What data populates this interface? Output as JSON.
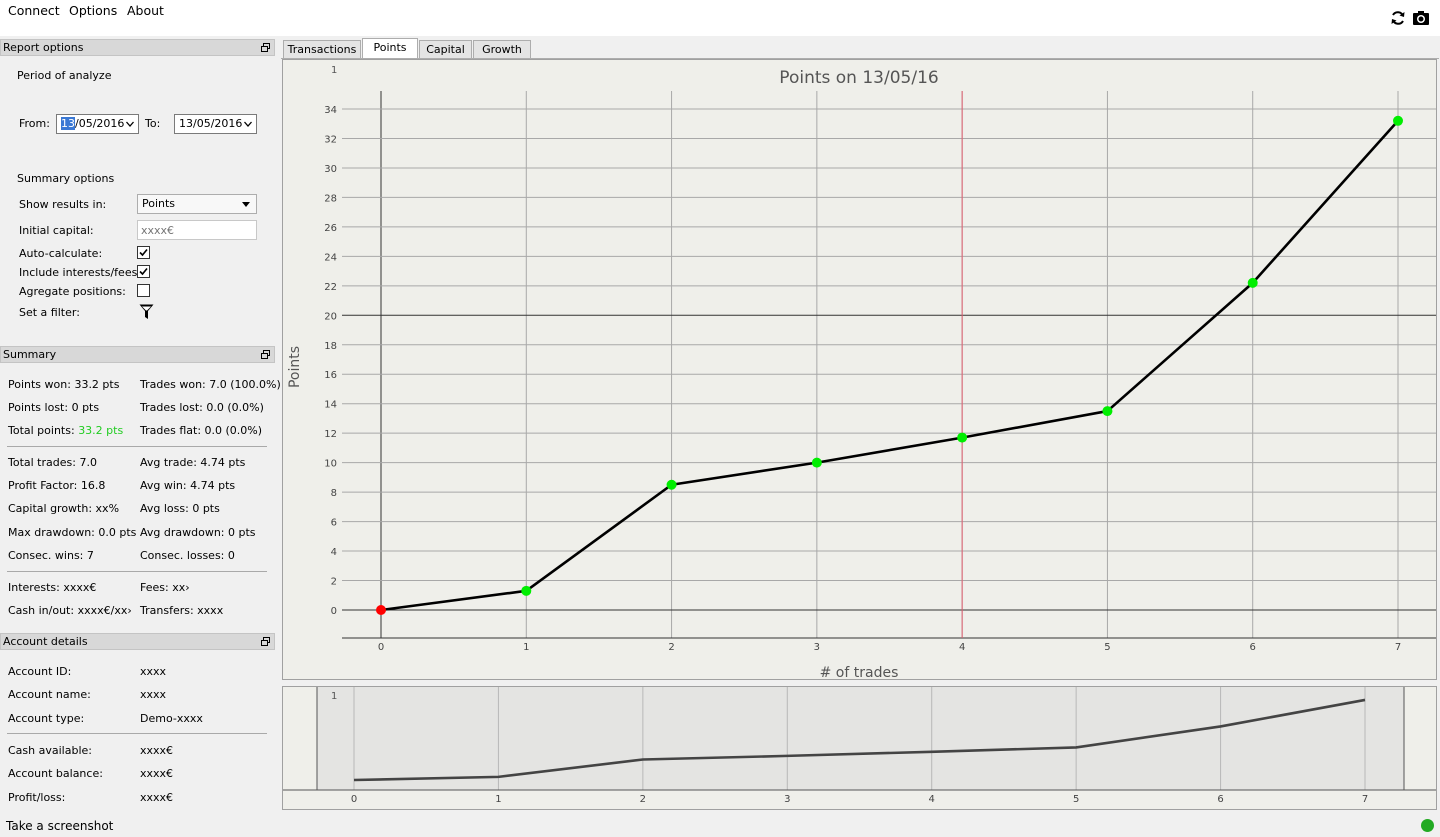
{
  "menu": {
    "items": [
      "Connect",
      "Options",
      "About"
    ]
  },
  "toolbar": {
    "refresh_icon": "refresh-icon",
    "screenshot_icon": "camera-icon"
  },
  "report_options": {
    "title": "Report options",
    "period_label": "Period of analyze",
    "from_label": "From:",
    "from_day": "13",
    "from_rest": "/05/2016",
    "to_label": "To:",
    "to_value": "13/05/2016",
    "summary_label": "Summary options",
    "show_results_label": "Show results in:",
    "show_results_value": "Points",
    "initial_capital_label": "Initial capital:",
    "initial_capital_placeholder": "xxxx€",
    "auto_calc_label": "Auto-calculate:",
    "auto_calc_checked": true,
    "include_fees_label": "Include interests/fees:",
    "include_fees_checked": true,
    "aggregate_label": "Agregate positions:",
    "aggregate_checked": false,
    "filter_label": "Set a filter:"
  },
  "summary": {
    "title": "Summary",
    "points_won": "Points won: 33.2 pts",
    "trades_won": "Trades won: 7.0 (100.0%)",
    "points_lost": "Points lost: 0 pts",
    "trades_lost": "Trades lost: 0.0 (0.0%)",
    "total_points_label": "Total points: ",
    "total_points_value": "33.2 pts",
    "trades_flat": "Trades flat: 0.0 (0.0%)",
    "total_trades": "Total trades: 7.0",
    "avg_trade": "Avg trade: 4.74 pts",
    "profit_factor": "Profit Factor: 16.8",
    "avg_win": "Avg win: 4.74 pts",
    "capital_growth": "Capital growth: xx%",
    "avg_loss": "Avg loss: 0 pts",
    "max_drawdown": "Max drawdown: 0.0 pts",
    "avg_drawdown": "Avg drawdown: 0 pts",
    "consec_wins": "Consec. wins: 7",
    "consec_losses": "Consec. losses: 0",
    "interests": "Interests: xxxx€",
    "fees": "Fees: xx›",
    "cash_in_out": "Cash in/out: xxxx€/xx›",
    "transfers": "Transfers: xxxx"
  },
  "account": {
    "title": "Account details",
    "id_label": "Account ID:",
    "id_value": "xxxx",
    "name_label": "Account name:",
    "name_value": "xxxx",
    "type_label": "Account type:",
    "type_value": "Demo-xxxx",
    "cash_label": "Cash available:",
    "cash_value": "xxxx€",
    "balance_label": "Account balance:",
    "balance_value": "xxxx€",
    "pl_label": "Profit/loss:",
    "pl_value": "xxxx€"
  },
  "tabs": [
    "Transactions",
    "Points",
    "Capital",
    "Growth"
  ],
  "active_tab": "Points",
  "status": {
    "text": "Take a screenshot",
    "indicator_color": "#22aa22"
  },
  "colors": {
    "positive": "#22cc22",
    "negative": "#ff0000",
    "marker_line": "#e06070"
  },
  "chart_data": {
    "type": "line",
    "title": "Points on 13/05/16",
    "xlabel": "# of trades",
    "ylabel": "Points",
    "corner_label": "1",
    "x": [
      0,
      1,
      2,
      3,
      4,
      5,
      6,
      7
    ],
    "y": [
      0,
      1.3,
      8.5,
      10.0,
      11.7,
      13.5,
      22.2,
      33.2
    ],
    "point_colors": [
      "#ff0000",
      "#00ee00",
      "#00ee00",
      "#00ee00",
      "#00ee00",
      "#00ee00",
      "#00ee00",
      "#00ee00"
    ],
    "xlim": [
      0,
      7
    ],
    "ylim": [
      0,
      34
    ],
    "y_ticks": [
      0,
      2,
      4,
      6,
      8,
      10,
      12,
      14,
      16,
      18,
      20,
      22,
      24,
      26,
      28,
      30,
      32,
      34
    ],
    "x_ticks": [
      0,
      1,
      2,
      3,
      4,
      5,
      6,
      7
    ],
    "highlight_x": 4,
    "reference_y": 20,
    "grid": true,
    "overview": {
      "corner_label": "1",
      "x_ticks": [
        0,
        1,
        2,
        3,
        4,
        5,
        6,
        7
      ]
    }
  }
}
